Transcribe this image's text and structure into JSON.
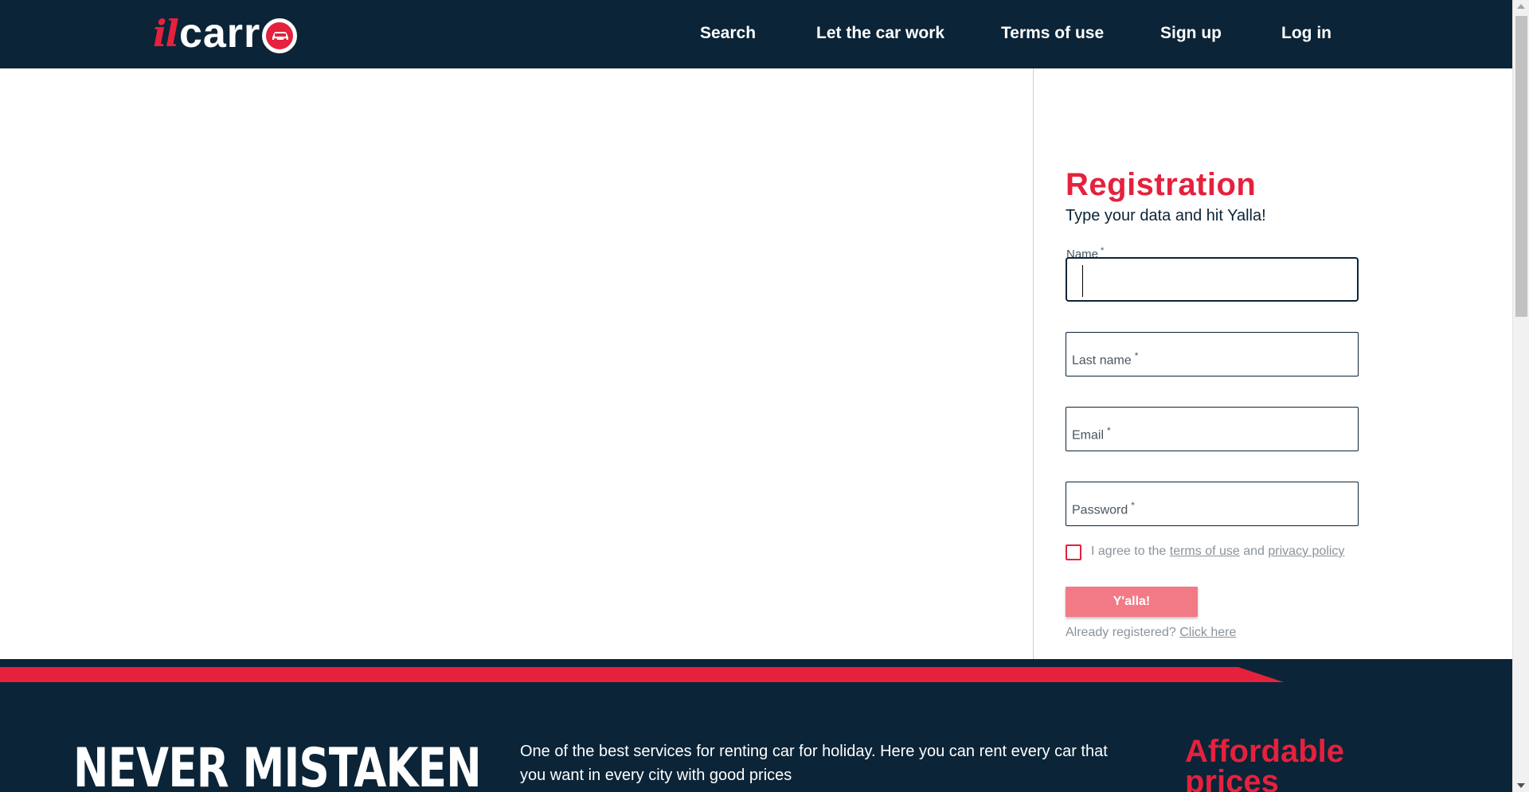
{
  "header": {
    "logo": {
      "prefix": "il",
      "main": "carr"
    },
    "nav": [
      "Search",
      "Let the car work",
      "Terms of use",
      "Sign up",
      "Log in"
    ]
  },
  "registration": {
    "title": "Registration",
    "subtitle": "Type your data and hit Yalla!",
    "fields": {
      "name": {
        "label": "Name",
        "value": ""
      },
      "last_name": {
        "label": "Last name",
        "value": ""
      },
      "email": {
        "label": "Email",
        "value": ""
      },
      "password": {
        "label": "Password",
        "value": ""
      }
    },
    "required_mark": "*",
    "agree": {
      "prefix": "I agree to the",
      "terms_link": "terms of use",
      "and": "and",
      "privacy_link": "privacy policy",
      "checked": false
    },
    "submit_label": "Y'alla!",
    "already": {
      "text": "Already registered?",
      "link": "Click here"
    }
  },
  "footer": {
    "headline": "NEVER MISTAKEN",
    "description": "One of the best services for renting car for holiday. Here you can rent every car that you want in every city with good prices",
    "right_title": "Affordable prices"
  },
  "colors": {
    "navy": "#0b2437",
    "brand_red": "#e5213d",
    "button_pink": "#f27a87"
  }
}
